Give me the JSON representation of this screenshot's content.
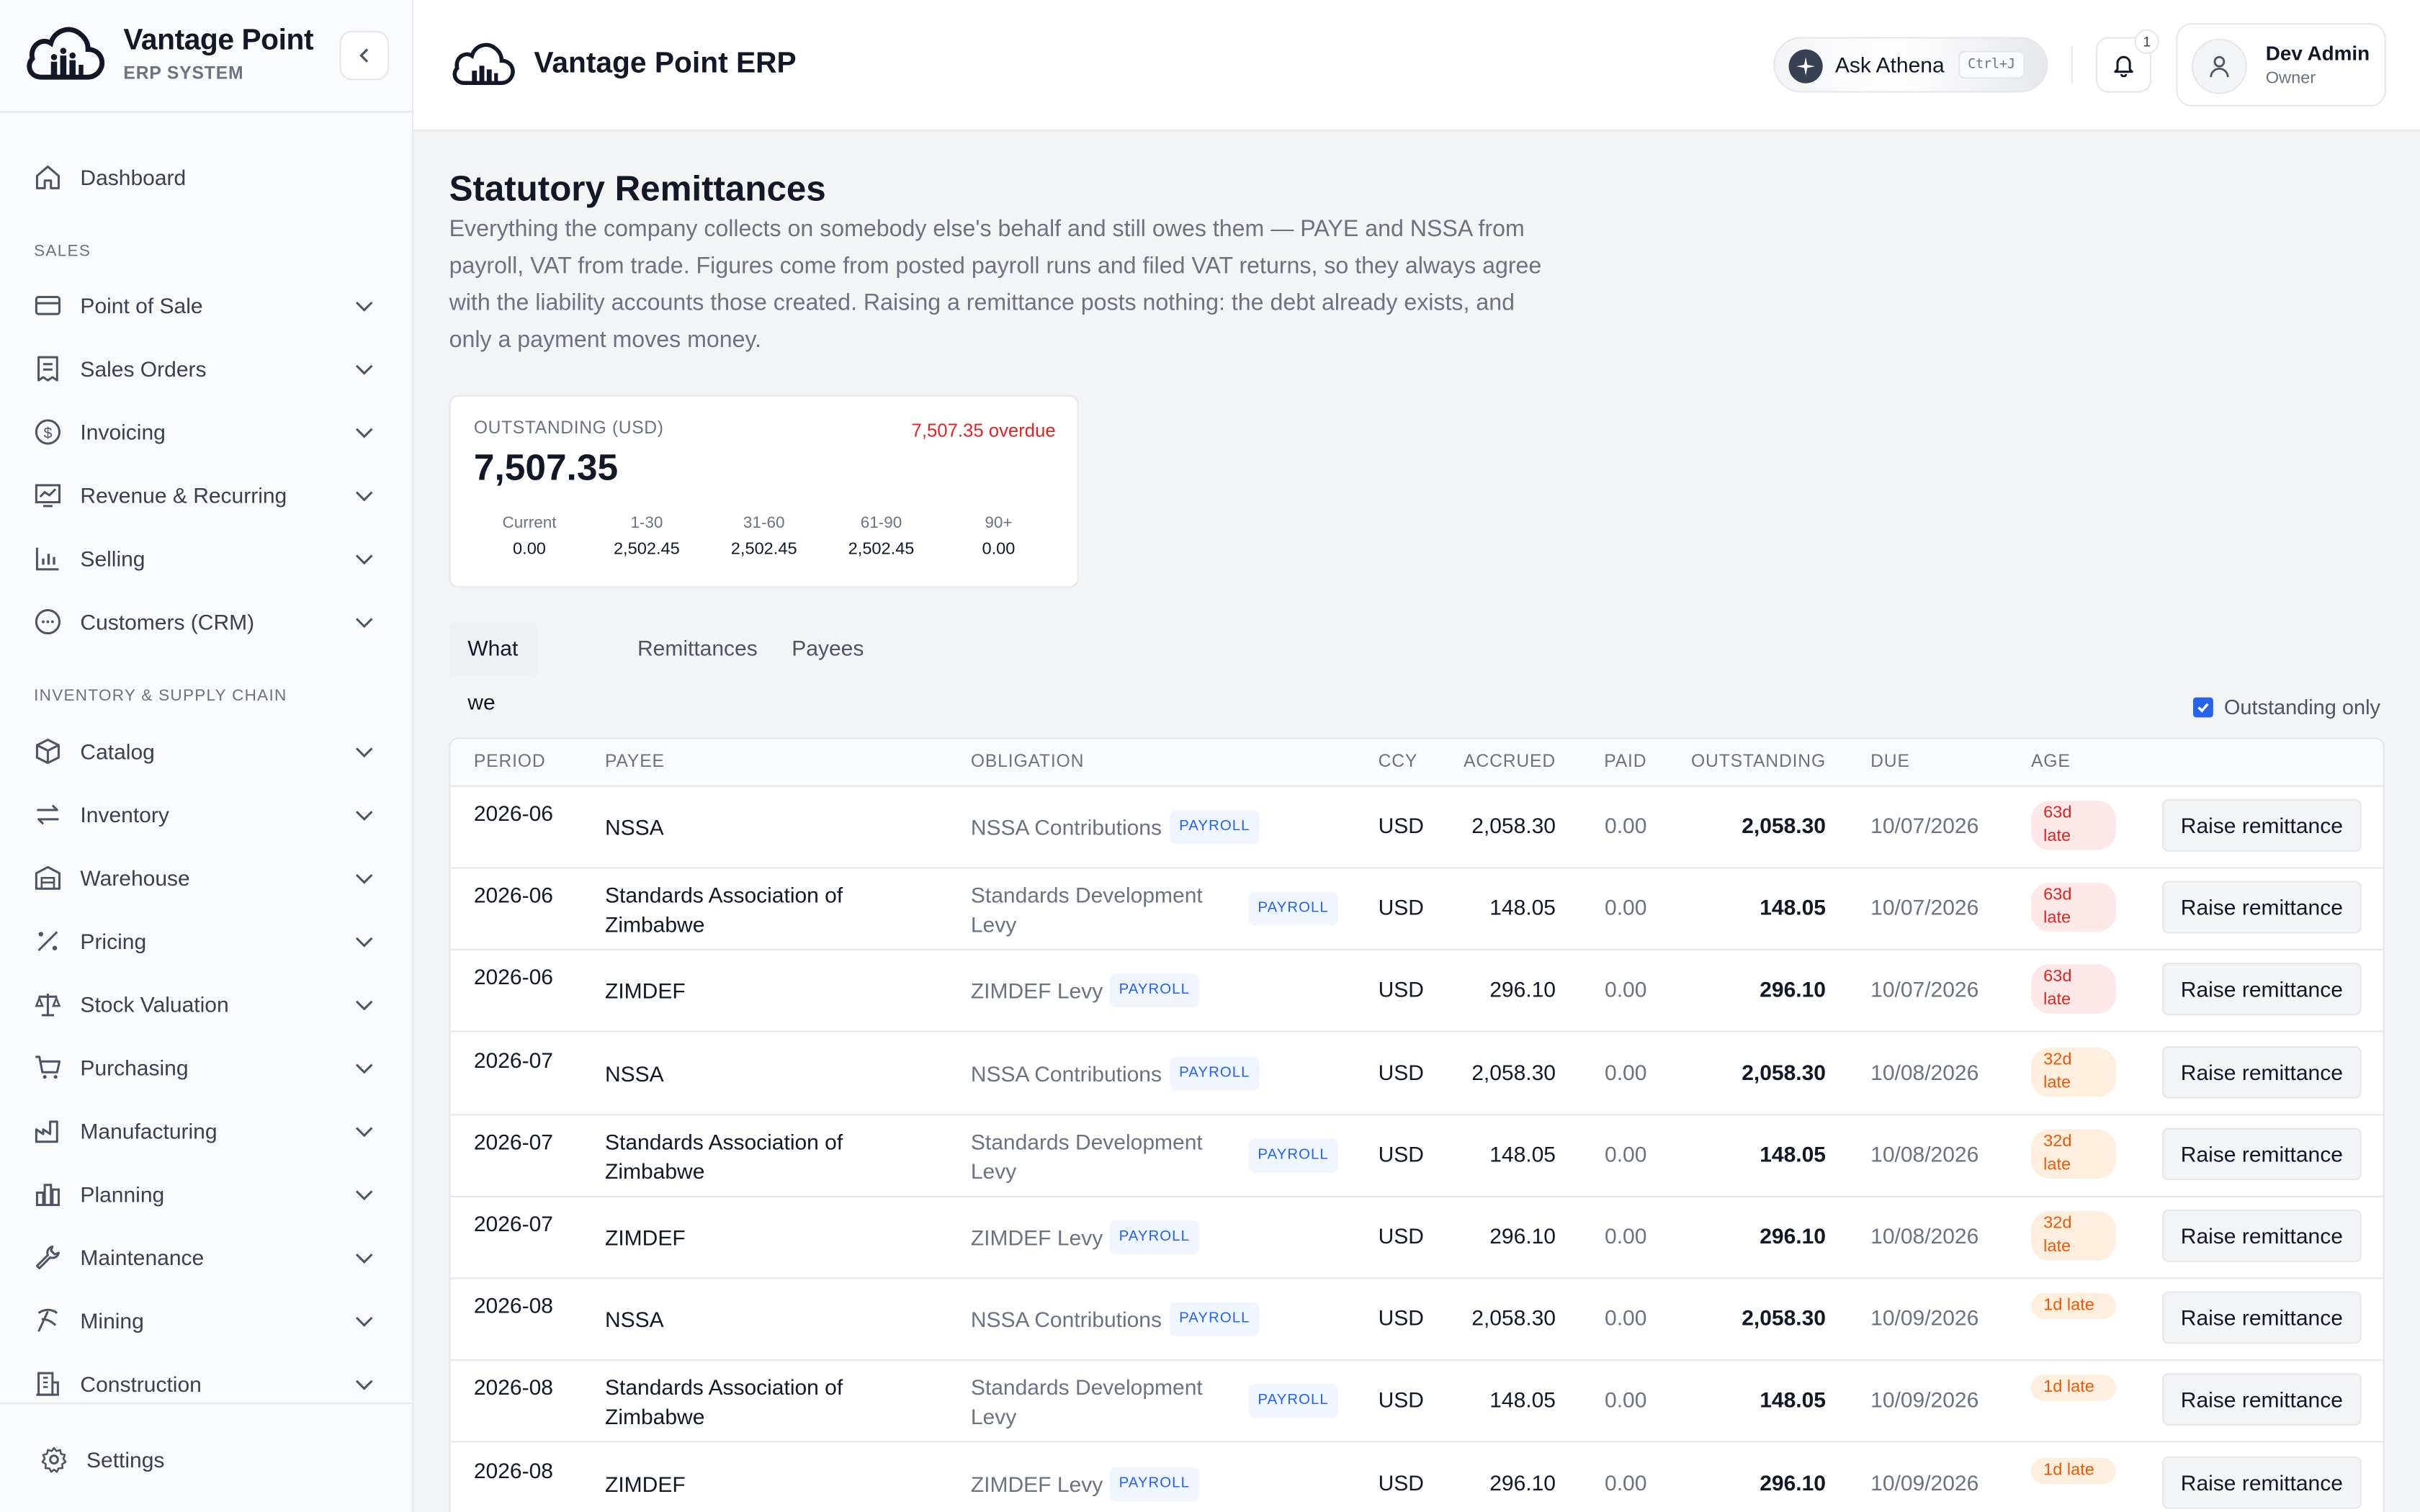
{
  "brand": {
    "name": "Vantage Point",
    "subtitle": "ERP SYSTEM"
  },
  "header": {
    "app_title": "Vantage Point ERP",
    "ask_label": "Ask Athena",
    "ask_shortcut": "Ctrl+J",
    "notification_count": "1",
    "user_name": "Dev Admin",
    "user_role": "Owner"
  },
  "sidebar": {
    "dashboard": "Dashboard",
    "sections": [
      {
        "title": "SALES",
        "items": [
          "Point of Sale",
          "Sales Orders",
          "Invoicing",
          "Revenue & Recurring",
          "Selling",
          "Customers (CRM)"
        ]
      },
      {
        "title": "INVENTORY & SUPPLY CHAIN",
        "items": [
          "Catalog",
          "Inventory",
          "Warehouse",
          "Pricing",
          "Stock Valuation",
          "Purchasing",
          "Manufacturing",
          "Planning",
          "Maintenance",
          "Mining",
          "Construction"
        ]
      }
    ],
    "settings": "Settings"
  },
  "page": {
    "title": "Statutory Remittances",
    "description": "Everything the company collects on somebody else's behalf and still owes them — PAYE and NSSA from payroll, VAT from trade. Figures come from posted payroll runs and filed VAT returns, so they always agree with the liability accounts those created. Raising a remittance posts nothing: the debt already exists, and only a payment moves money."
  },
  "summary": {
    "label": "OUTSTANDING (USD)",
    "overdue": "7,507.35 overdue",
    "total": "7,507.35",
    "buckets": [
      {
        "label": "Current",
        "value": "0.00"
      },
      {
        "label": "1-30",
        "value": "2,502.45"
      },
      {
        "label": "31-60",
        "value": "2,502.45"
      },
      {
        "label": "61-90",
        "value": "2,502.45"
      },
      {
        "label": "90+",
        "value": "0.00"
      }
    ]
  },
  "tabs": [
    "What we owe",
    "Remittances",
    "Payees"
  ],
  "active_tab": "What we owe",
  "filter": {
    "label": "Outstanding only",
    "checked": true
  },
  "table": {
    "columns": [
      "PERIOD",
      "PAYEE",
      "OBLIGATION",
      "CCY",
      "ACCRUED",
      "PAID",
      "OUTSTANDING",
      "DUE",
      "AGE"
    ],
    "action_label": "Raise remittance",
    "rows": [
      {
        "period": "2026-06",
        "payee": "NSSA",
        "obligation": "NSSA Contributions",
        "tag": "PAYROLL",
        "ccy": "USD",
        "accrued": "2,058.30",
        "paid": "0.00",
        "outstanding": "2,058.30",
        "due": "10/07/2026",
        "age": "63d late",
        "age_color": "#dc2626"
      },
      {
        "period": "2026-06",
        "payee": "Standards Association of Zimbabwe",
        "obligation": "Standards Development Levy",
        "tag": "PAYROLL",
        "ccy": "USD",
        "accrued": "148.05",
        "paid": "0.00",
        "outstanding": "148.05",
        "due": "10/07/2026",
        "age": "63d late",
        "age_color": "#dc2626"
      },
      {
        "period": "2026-06",
        "payee": "ZIMDEF",
        "obligation": "ZIMDEF Levy",
        "tag": "PAYROLL",
        "ccy": "USD",
        "accrued": "296.10",
        "paid": "0.00",
        "outstanding": "296.10",
        "due": "10/07/2026",
        "age": "63d late",
        "age_color": "#dc2626"
      },
      {
        "period": "2026-07",
        "payee": "NSSA",
        "obligation": "NSSA Contributions",
        "tag": "PAYROLL",
        "ccy": "USD",
        "accrued": "2,058.30",
        "paid": "0.00",
        "outstanding": "2,058.30",
        "due": "10/08/2026",
        "age": "32d late",
        "age_color": "#ea580c"
      },
      {
        "period": "2026-07",
        "payee": "Standards Association of Zimbabwe",
        "obligation": "Standards Development Levy",
        "tag": "PAYROLL",
        "ccy": "USD",
        "accrued": "148.05",
        "paid": "0.00",
        "outstanding": "148.05",
        "due": "10/08/2026",
        "age": "32d late",
        "age_color": "#ea580c"
      },
      {
        "period": "2026-07",
        "payee": "ZIMDEF",
        "obligation": "ZIMDEF Levy",
        "tag": "PAYROLL",
        "ccy": "USD",
        "accrued": "296.10",
        "paid": "0.00",
        "outstanding": "296.10",
        "due": "10/08/2026",
        "age": "32d late",
        "age_color": "#ea580c"
      },
      {
        "period": "2026-08",
        "payee": "NSSA",
        "obligation": "NSSA Contributions",
        "tag": "PAYROLL",
        "ccy": "USD",
        "accrued": "2,058.30",
        "paid": "0.00",
        "outstanding": "2,058.30",
        "due": "10/09/2026",
        "age": "1d late",
        "age_color": "#ea580c"
      },
      {
        "period": "2026-08",
        "payee": "Standards Association of Zimbabwe",
        "obligation": "Standards Development Levy",
        "tag": "PAYROLL",
        "ccy": "USD",
        "accrued": "148.05",
        "paid": "0.00",
        "outstanding": "148.05",
        "due": "10/09/2026",
        "age": "1d late",
        "age_color": "#ea580c"
      },
      {
        "period": "2026-08",
        "payee": "ZIMDEF",
        "obligation": "ZIMDEF Levy",
        "tag": "PAYROLL",
        "ccy": "USD",
        "accrued": "296.10",
        "paid": "0.00",
        "outstanding": "296.10",
        "due": "10/09/2026",
        "age": "1d late",
        "age_color": "#ea580c"
      }
    ]
  },
  "colors": {
    "accent": "#2563eb",
    "overdue": "#dc2626",
    "late": "#ea580c",
    "muted": "#6b7280"
  },
  "icons": [
    "cloud-logo-icon",
    "chevron-left-icon",
    "home-icon",
    "card-icon",
    "receipt-icon",
    "dollar-icon",
    "trend-icon",
    "bar-chart-icon",
    "chat-icon",
    "box-icon",
    "arrows-icon",
    "warehouse-icon",
    "percent-icon",
    "scale-icon",
    "cart-icon",
    "factory-icon",
    "planning-icon",
    "wrench-icon",
    "pickaxe-icon",
    "building-icon",
    "gear-icon",
    "sparkle-icon",
    "bell-icon",
    "user-icon",
    "chevron-down-icon"
  ]
}
